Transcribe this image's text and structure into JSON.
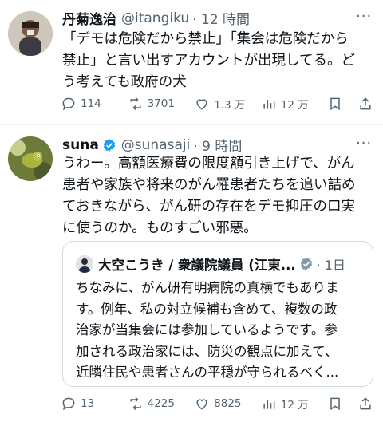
{
  "tweet1": {
    "name": "丹菊逸治",
    "handle": "@itangiku",
    "time": "· 12 時間",
    "lines": [
      "「デモは危険だから禁止」「集会は危険だから",
      "禁止」と言い出すアカウントが出現してる。ど",
      "う考えても政府の犬"
    ],
    "replies": "114",
    "retweets": "3701",
    "likes": "1.3 万",
    "views": "12 万"
  },
  "tweet2": {
    "name": "suna",
    "handle": "@sunasaji",
    "time": "· 9 時間",
    "lines": [
      "うわー。高額医療費の限度額引き上げで、がん",
      "患者や家族や将来のがん罹患者たちを追い詰め",
      "ておきながら、がん研の存在をデモ抑圧の口実",
      "に使うのか。ものすごい邪悪。"
    ],
    "replies": "13",
    "retweets": "4225",
    "likes": "8825",
    "views": "12 万",
    "quote": {
      "name": "大空こうき / 衆議院議員 (江東...",
      "time": "· 1日",
      "lines": [
        "ちなみに、がん研有明病院の真横でもありま",
        "す。例年、私の対立候補も含めて、複数の政",
        "治家が当集会には参加しているようです。参",
        "加される政治家には、防災の観点に加えて、",
        "近隣住民や患者さんの平穏が守られるべく..."
      ]
    }
  },
  "colors": {
    "text": "#0f1419",
    "muted": "#536471",
    "verified": "#1d9bf0",
    "border": "#cfd9de"
  }
}
